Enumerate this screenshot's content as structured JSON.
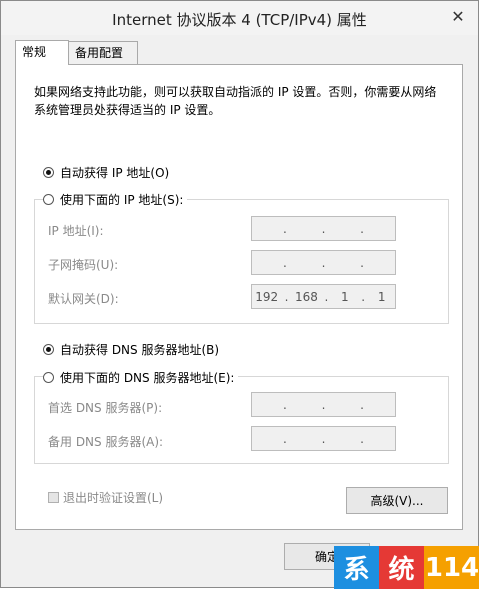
{
  "window": {
    "title": "Internet 协议版本 4 (TCP/IPv4) 属性",
    "close_glyph": "✕"
  },
  "tabs": [
    {
      "label": "常规"
    },
    {
      "label": "备用配置"
    }
  ],
  "description": "如果网络支持此功能，则可以获取自动指派的 IP 设置。否则，你需要从网络系统管理员处获得适当的 IP 设置。",
  "ip_mode": {
    "auto_label": "自动获得 IP 地址(O)",
    "manual_label": "使用下面的 IP 地址(S):",
    "selected": "auto"
  },
  "ip_fields": [
    {
      "label": "IP 地址(I):",
      "octets": [
        "",
        "",
        "",
        ""
      ]
    },
    {
      "label": "子网掩码(U):",
      "octets": [
        "",
        "",
        "",
        ""
      ]
    },
    {
      "label": "默认网关(D):",
      "octets": [
        "192",
        "168",
        "1",
        "1"
      ]
    }
  ],
  "dns_mode": {
    "auto_label": "自动获得 DNS 服务器地址(B)",
    "manual_label": "使用下面的 DNS 服务器地址(E):",
    "selected": "auto"
  },
  "dns_fields": [
    {
      "label": "首选 DNS 服务器(P):",
      "octets": [
        "",
        "",
        "",
        ""
      ]
    },
    {
      "label": "备用 DNS 服务器(A):",
      "octets": [
        "",
        "",
        "",
        ""
      ]
    }
  ],
  "validate_checkbox": {
    "label": "退出时验证设置(L)",
    "checked": false,
    "enabled": false
  },
  "advanced_button": "高级(V)...",
  "ok_button": "确定",
  "watermark": {
    "chars": [
      "系",
      "统",
      "114"
    ],
    "colors": [
      "#1d8fe0",
      "#e53935",
      "#f5a000"
    ]
  }
}
